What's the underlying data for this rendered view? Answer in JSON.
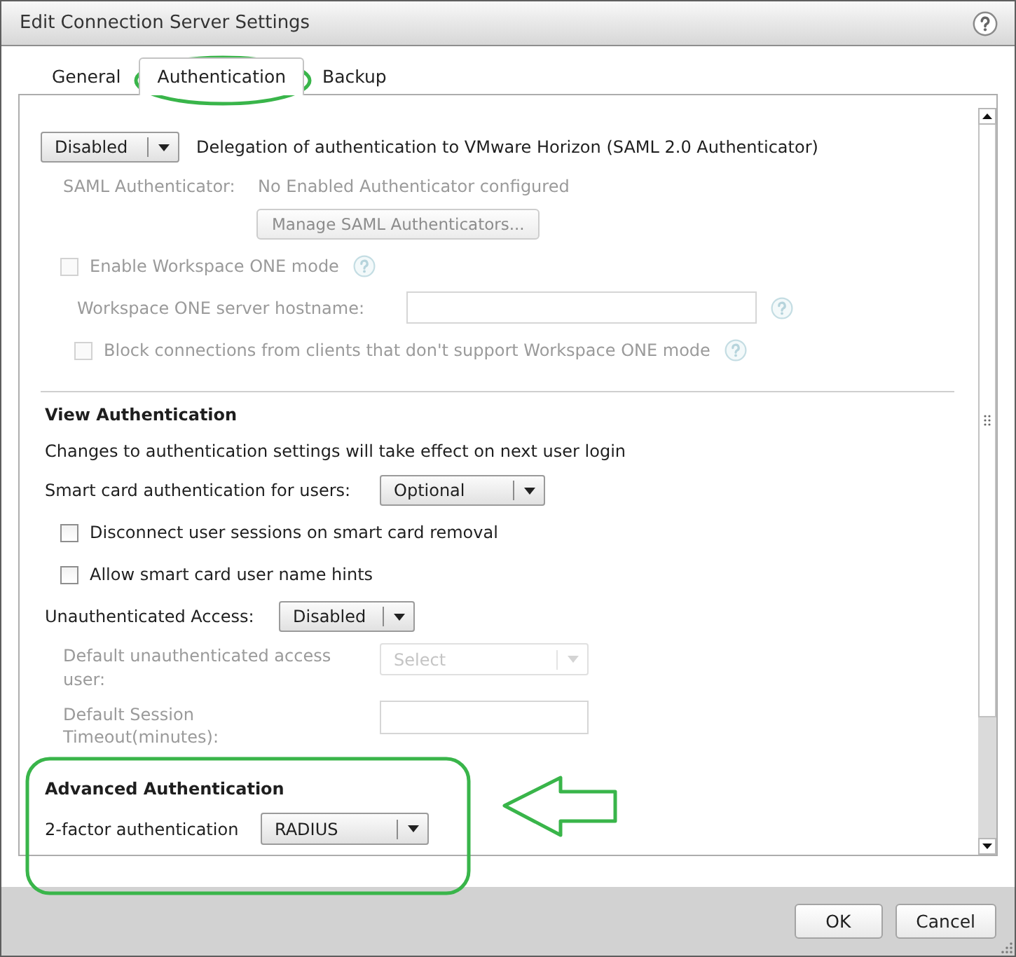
{
  "window": {
    "title": "Edit Connection Server Settings"
  },
  "tabs": [
    {
      "label": "General",
      "selected": false
    },
    {
      "label": "Authentication",
      "selected": true
    },
    {
      "label": "Backup",
      "selected": false
    }
  ],
  "saml": {
    "delegation": {
      "value": "Disabled",
      "label": "Delegation of authentication to VMware Horizon (SAML 2.0 Authenticator)"
    },
    "authenticator": {
      "label": "SAML Authenticator:",
      "value": "No Enabled Authenticator configured",
      "disabled": true
    },
    "manage_button": {
      "label": "Manage SAML Authenticators...",
      "disabled": true
    },
    "workspace_one_mode": {
      "label": "Enable Workspace ONE mode",
      "checked": false,
      "disabled": true
    },
    "hostname": {
      "label": "Workspace ONE server hostname:",
      "disabled": true
    },
    "block_clients": {
      "label": "Block connections from clients that don't support Workspace ONE mode",
      "checked": false,
      "disabled": true
    }
  },
  "view_authentication": {
    "heading": "View Authentication",
    "note": "Changes to authentication settings will take effect on next user login",
    "smart_card": {
      "label": "Smart card authentication for users:",
      "value": "Optional"
    },
    "options": [
      {
        "label": "Disconnect user sessions on smart card removal",
        "checked": false
      },
      {
        "label": "Allow smart card user name hints",
        "checked": false
      }
    ],
    "unauthenticated_access": {
      "label": "Unauthenticated Access:",
      "value": "Disabled"
    },
    "default_user": {
      "label": "Default unauthenticated access user:",
      "placeholder": "Select",
      "disabled": true
    },
    "session_timeout": {
      "label": "Default Session Timeout(minutes):",
      "disabled": true
    }
  },
  "advanced_authentication": {
    "heading": "Advanced Authentication",
    "two_factor": {
      "label": "2-factor authentication",
      "value": "RADIUS"
    }
  },
  "buttons": [
    {
      "label": "OK"
    },
    {
      "label": "Cancel"
    }
  ]
}
